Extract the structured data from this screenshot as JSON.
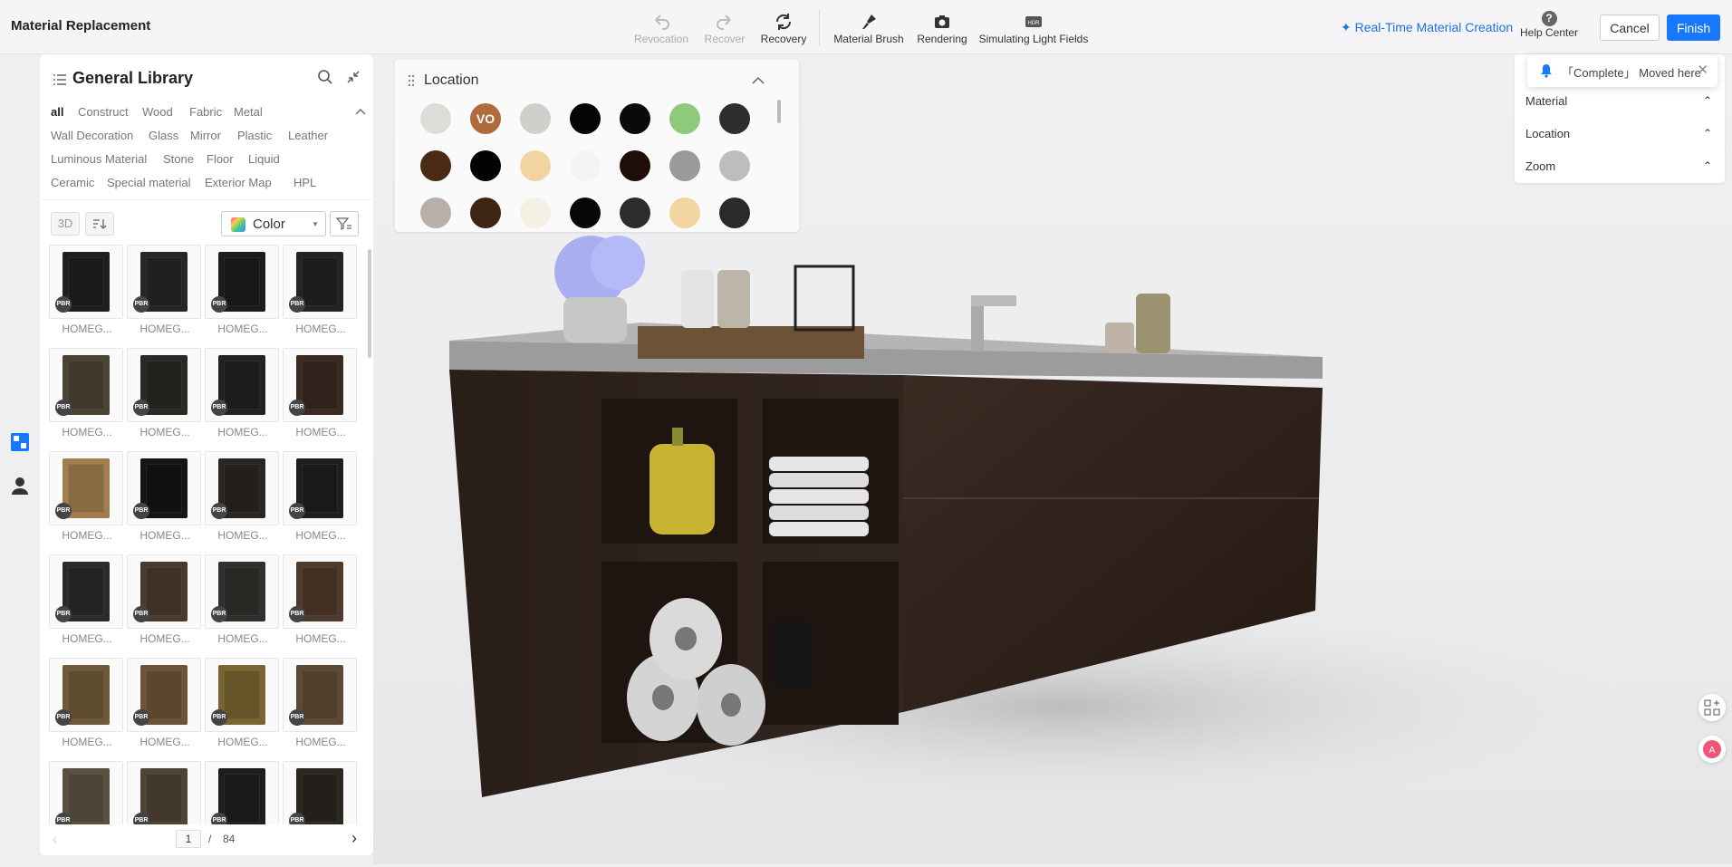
{
  "app": {
    "title": "Material Replacement"
  },
  "toolbar": {
    "revocation": "Revocation",
    "recover": "Recover",
    "recovery": "Recovery",
    "material_brush": "Material Brush",
    "rendering": "Rendering",
    "simulating_light_fields": "Simulating Light Fields"
  },
  "header_right": {
    "realtime": "Real-Time Material Creation",
    "help": "Help Center",
    "help_glyph": "?",
    "cancel": "Cancel",
    "finish": "Finish"
  },
  "library": {
    "title": "General Library",
    "categories": [
      "all",
      "Construct",
      "Wood",
      "Fabric",
      "Metal",
      "Wall Decoration",
      "Glass",
      "Mirror",
      "Plastic",
      "Leather",
      "Luminous Material",
      "Stone",
      "Floor",
      "Liquid",
      "Ceramic",
      "Special material",
      "Exterior Map",
      "HPL"
    ],
    "btn_3d": "3D",
    "color_label": "Color",
    "badge": "PBR",
    "tiles": [
      {
        "name": "HOMEG...",
        "color": "#1f1f1f"
      },
      {
        "name": "HOMEG...",
        "color": "#262626"
      },
      {
        "name": "HOMEG...",
        "color": "#1c1c1c"
      },
      {
        "name": "HOMEG...",
        "color": "#232323"
      },
      {
        "name": "HOMEG...",
        "color": "#4a4434"
      },
      {
        "name": "HOMEG...",
        "color": "#2b2925"
      },
      {
        "name": "HOMEG...",
        "color": "#222222"
      },
      {
        "name": "HOMEG...",
        "color": "#3a2a22"
      },
      {
        "name": "HOMEG...",
        "color": "#a37d4e"
      },
      {
        "name": "HOMEG...",
        "color": "#151515"
      },
      {
        "name": "HOMEG...",
        "color": "#2a2521"
      },
      {
        "name": "HOMEG...",
        "color": "#1e1e1e"
      },
      {
        "name": "HOMEG...",
        "color": "#2a2a2a"
      },
      {
        "name": "HOMEG...",
        "color": "#4a3a2e"
      },
      {
        "name": "HOMEG...",
        "color": "#2f2f2c"
      },
      {
        "name": "HOMEG...",
        "color": "#4e3a2a"
      },
      {
        "name": "HOMEG...",
        "color": "#6e5a36"
      },
      {
        "name": "HOMEG...",
        "color": "#6c5436"
      },
      {
        "name": "HOMEG...",
        "color": "#7a6432"
      },
      {
        "name": "HOMEG...",
        "color": "#5e4a34"
      },
      {
        "name": "HOMEG...",
        "color": "#5a5040"
      },
      {
        "name": "HOMEG...",
        "color": "#4e4434"
      },
      {
        "name": "HOMEG...",
        "color": "#1e1e1e"
      },
      {
        "name": "HOMEG...",
        "color": "#2a2622"
      }
    ],
    "page": "1",
    "page_sep": "/",
    "total": "84"
  },
  "location_panel": {
    "title": "Location",
    "swatches": [
      {
        "color": "#dcdcd8",
        "label": ""
      },
      {
        "color": "#b06a3c",
        "label": "VO"
      },
      {
        "color": "#cfcfcc",
        "label": ""
      },
      {
        "color": "#050505",
        "label": ""
      },
      {
        "color": "#0a0a0a",
        "label": ""
      },
      {
        "color": "#8fc97a",
        "label": ""
      },
      {
        "color": "#2e2e2e",
        "label": ""
      },
      {
        "color": "#4a2a14",
        "label": ""
      },
      {
        "color": "#030303",
        "label": ""
      },
      {
        "color": "#f2d4a0",
        "label": ""
      },
      {
        "color": "#f4f4f4",
        "label": ""
      },
      {
        "color": "#1e0d08",
        "label": ""
      },
      {
        "color": "#9a9a9a",
        "label": ""
      },
      {
        "color": "#bdbdbd",
        "label": ""
      },
      {
        "color": "#b8b0a8",
        "label": ""
      },
      {
        "color": "#3e2412",
        "label": ""
      },
      {
        "color": "#f4f0e4",
        "label": ""
      },
      {
        "color": "#080808",
        "label": ""
      },
      {
        "color": "#2c2c2c",
        "label": ""
      },
      {
        "color": "#f2d4a0",
        "label": ""
      },
      {
        "color": "#2a2a2a",
        "label": ""
      }
    ]
  },
  "right_panel": {
    "items": [
      "Material",
      "Location",
      "Zoom"
    ],
    "toast": "「Complete」 Moved here"
  }
}
